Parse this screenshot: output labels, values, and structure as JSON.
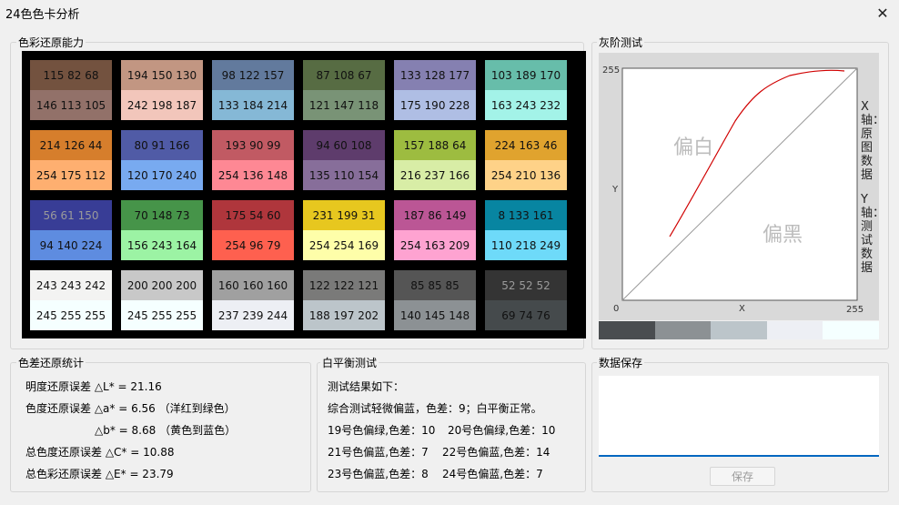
{
  "window": {
    "title": "24色色卡分析",
    "close_glyph": "✕"
  },
  "color_panel": {
    "label": "色彩还原能力",
    "swatches": [
      {
        "top": "115 82 68",
        "top_color": "#73523f",
        "bot": "146 113 105",
        "bot_color": "#927169"
      },
      {
        "top": "194 150 130",
        "top_color": "#c29682",
        "bot": "242 198 187",
        "bot_color": "#f2c6bb"
      },
      {
        "top": "98 122 157",
        "top_color": "#627a9d",
        "bot": "133 184 214",
        "bot_color": "#85b8d6"
      },
      {
        "top": "87 108 67",
        "top_color": "#576c43",
        "bot": "121 147 118",
        "bot_color": "#799376"
      },
      {
        "top": "133 128 177",
        "top_color": "#8580b1",
        "bot": "175 190 228",
        "bot_color": "#afbee4"
      },
      {
        "top": "103 189 170",
        "top_color": "#67bdaa",
        "bot": "163 243 232",
        "bot_color": "#a3f3e8"
      },
      {
        "top": "214 126 44",
        "top_color": "#d67e2c",
        "bot": "254 175 112",
        "bot_color": "#feaf70"
      },
      {
        "top": "80 91 166",
        "top_color": "#505ba6",
        "bot": "120 170 240",
        "bot_color": "#78aaf0"
      },
      {
        "top": "193 90 99",
        "top_color": "#c15a63",
        "bot": "254 136 148",
        "bot_color": "#fe8894"
      },
      {
        "top": "94 60 108",
        "top_color": "#5e3c6c",
        "bot": "135 110 154",
        "bot_color": "#876e9a"
      },
      {
        "top": "157 188 64",
        "top_color": "#9dbc40",
        "bot": "216 237 166",
        "bot_color": "#d8eda6"
      },
      {
        "top": "224 163 46",
        "top_color": "#e0a32e",
        "bot": "254 210 136",
        "bot_color": "#fed288"
      },
      {
        "top": "56 61 150",
        "top_color": "#383d96",
        "bot": "94 140 224",
        "bot_color": "#5e8ce0"
      },
      {
        "top": "70 148 73",
        "top_color": "#469449",
        "bot": "156 243 164",
        "bot_color": "#9cf3a4"
      },
      {
        "top": "175 54 60",
        "top_color": "#af363c",
        "bot": "254 96 79",
        "bot_color": "#fe604f"
      },
      {
        "top": "231 199 31",
        "top_color": "#e7c71f",
        "bot": "254 254 169",
        "bot_color": "#fefea9"
      },
      {
        "top": "187 86 149",
        "top_color": "#bb5695",
        "bot": "254 163 209",
        "bot_color": "#fea3d1"
      },
      {
        "top": "8 133 161",
        "top_color": "#0885a1",
        "bot": "110 218 249",
        "bot_color": "#6edaf9"
      },
      {
        "top": "243 243 242",
        "top_color": "#f3f3f2",
        "bot": "245 255 255",
        "bot_color": "#f5ffff"
      },
      {
        "top": "200 200 200",
        "top_color": "#c8c8c8",
        "bot": "245 255 255",
        "bot_color": "#f5ffff"
      },
      {
        "top": "160 160 160",
        "top_color": "#a0a0a0",
        "bot": "237 239 244",
        "bot_color": "#edeff4"
      },
      {
        "top": "122 122 121",
        "top_color": "#7a7a79",
        "bot": "188 197 202",
        "bot_color": "#bcc5ca"
      },
      {
        "top": "85 85 85",
        "top_color": "#555555",
        "bot": "140 145 148",
        "bot_color": "#8c9194"
      },
      {
        "top": "52 52 52",
        "top_color": "#343434",
        "bot": "69 74 76",
        "bot_color": "#454a4c"
      }
    ]
  },
  "gray_panel": {
    "label": "灰阶测试",
    "y_max": "255",
    "x_max": "255",
    "origin": "0",
    "x_label": "X",
    "y_label": "Y",
    "bias_white": "偏白",
    "bias_black": "偏黑",
    "side_text_x": "X轴：原图数据",
    "side_text_y": "Y轴：测试数据",
    "gray_bars": [
      "#4a4d50",
      "#8c9194",
      "#bcc5ca",
      "#edeff4",
      "#f5ffff"
    ]
  },
  "stats_panel": {
    "label": "色差还原统计",
    "lines": [
      "明度还原误差 △L* = 21.16",
      "色度还原误差 △a* = 6.56 （洋红到绿色）",
      "△b* = 8.68 （黄色到蓝色）",
      "总色度还原误差 △C* = 10.88",
      "总色彩还原误差 △E* = 23.79"
    ]
  },
  "wb_panel": {
    "label": "白平衡测试",
    "lines": [
      "测试结果如下：",
      "综合测试轻微偏蓝，色差：9；白平衡正常。",
      "19号色偏绿,色差：10",
      "20号色偏绿,色差：10",
      "21号色偏蓝,色差：7",
      "22号色偏蓝,色差：14",
      "23号色偏蓝,色差：8",
      "24号色偏蓝,色差：7"
    ]
  },
  "save_panel": {
    "label": "数据保存",
    "button": "保存",
    "text": ""
  }
}
